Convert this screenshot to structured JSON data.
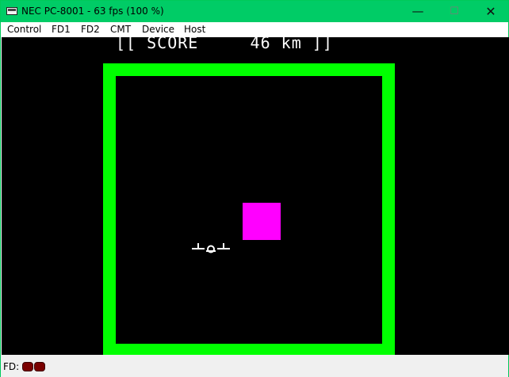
{
  "window": {
    "title": "NEC PC-8001 - 63 fps (100 %)",
    "controls": {
      "minimize": "—",
      "maximize": "☐",
      "close": "✕"
    },
    "colors": {
      "titlebar": "#00cc66",
      "screen_background": "#000000",
      "playfield_border": "#00ff00",
      "obstacle": "#ff00ff",
      "text": "#ffffff",
      "status_led": "#7a0000"
    }
  },
  "menu": {
    "items": [
      "Control",
      "FD1",
      "FD2",
      "CMT",
      "Device",
      "Host"
    ]
  },
  "game": {
    "score_text": "[[ SCORE     46 km ]]",
    "player_ship_icon": "ship-icon",
    "obstacle_icon": "magenta-square-obstacle"
  },
  "status": {
    "fd_label": "FD:",
    "leds": [
      "led-fd1",
      "led-fd2"
    ]
  }
}
